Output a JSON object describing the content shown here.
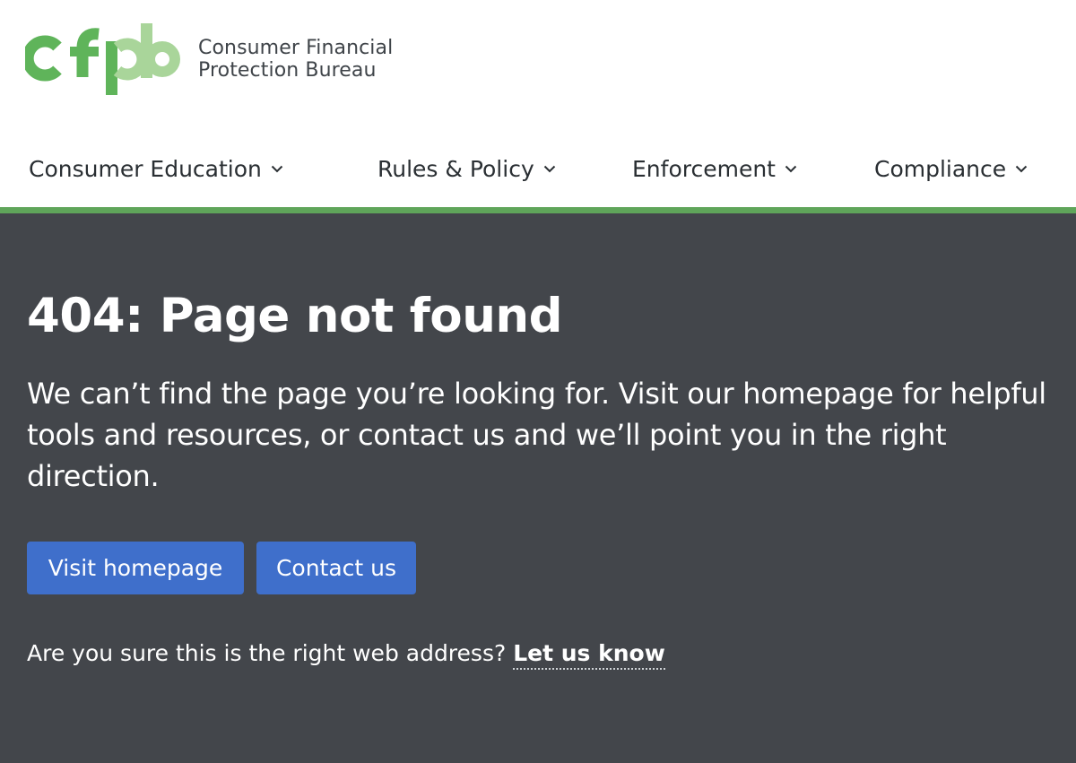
{
  "brand": {
    "abbreviation": "cfpb",
    "name_line1": "Consumer Financial",
    "name_line2": "Protection Bureau",
    "color_dark_green": "#5fb45a",
    "color_light_green": "#a9d59a"
  },
  "nav": {
    "items": [
      {
        "label": "Consumer Education",
        "icon": "chevron-down-icon"
      },
      {
        "label": "Rules & Policy",
        "icon": "chevron-down-icon"
      },
      {
        "label": "Enforcement",
        "icon": "chevron-down-icon"
      },
      {
        "label": "Compliance",
        "icon": "chevron-down-icon"
      }
    ]
  },
  "main": {
    "title": "404: Page not found",
    "lede": "We can’t find the page you’re looking for. Visit our homepage for helpful tools and resources, or contact us and we’ll point you in the right direction.",
    "buttons": {
      "homepage": "Visit homepage",
      "contact": "Contact us"
    },
    "note_text": "Are you sure this is the right web address?",
    "note_link": "Let us know",
    "background_color": "#43464b",
    "accent_bar_color": "#5fa55a",
    "button_color": "#3f6fcb"
  }
}
